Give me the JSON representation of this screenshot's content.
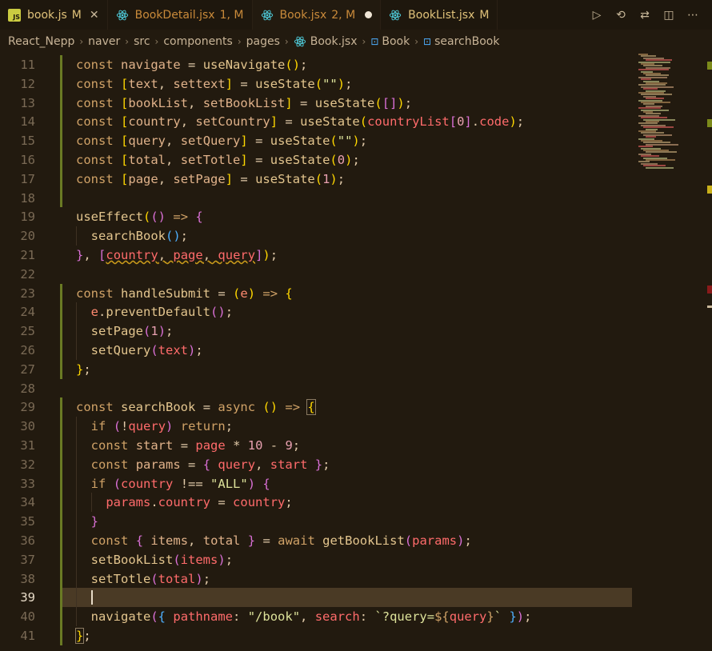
{
  "tabs": [
    {
      "label": "book.js",
      "status": "M",
      "icon": "js-icon",
      "color": "#e0c27a",
      "active": false,
      "closable": true
    },
    {
      "label": "BookDetail.jsx",
      "status": "1, M",
      "icon": "react-icon",
      "color": "#c98a3a",
      "active": false
    },
    {
      "label": "Book.jsx",
      "status": "2, M",
      "icon": "react-icon",
      "color": "#c98a3a",
      "active": true,
      "dirty": true
    },
    {
      "label": "BookList.jsx",
      "status": "M",
      "icon": "react-icon",
      "color": "#e0c27a",
      "active": false
    }
  ],
  "breadcrumb": {
    "items": [
      "React_Nepp",
      "naver",
      "src",
      "components",
      "pages",
      "Book.jsx",
      "Book",
      "searchBook"
    ]
  },
  "editor": {
    "current_line": 39,
    "lines": [
      {
        "n": "11",
        "html": "<span class='kw'>const</span> <span class='var'>navigate</span> <span class='pl'>=</span> <span class='fn'>useNavigate</span><span class='br1'>()</span><span class='pl'>;</span>"
      },
      {
        "n": "12",
        "html": "<span class='kw'>const</span> <span class='br1'>[</span><span class='var'>text</span><span class='pl'>,</span> <span class='var'>settext</span><span class='br1'>]</span> <span class='pl'>=</span> <span class='fn'>useState</span><span class='br1'>(</span><span class='str'>\"\"</span><span class='br1'>)</span><span class='pl'>;</span>"
      },
      {
        "n": "13",
        "html": "<span class='kw'>const</span> <span class='br1'>[</span><span class='var'>bookList</span><span class='pl'>,</span> <span class='var'>setBookList</span><span class='br1'>]</span> <span class='pl'>=</span> <span class='fn'>useState</span><span class='br1'>(</span><span class='br2'>[]</span><span class='br1'>)</span><span class='pl'>;</span>"
      },
      {
        "n": "14",
        "html": "<span class='kw'>const</span> <span class='br1'>[</span><span class='var'>country</span><span class='pl'>,</span> <span class='var'>setCountry</span><span class='br1'>]</span> <span class='pl'>=</span> <span class='fn'>useState</span><span class='br1'>(</span><span class='prop'>countryList</span><span class='br2'>[</span><span class='num'>0</span><span class='br2'>]</span><span class='pl'>.</span><span class='prop'>code</span><span class='br1'>)</span><span class='pl'>;</span>"
      },
      {
        "n": "15",
        "html": "<span class='kw'>const</span> <span class='br1'>[</span><span class='var'>query</span><span class='pl'>,</span> <span class='var'>setQuery</span><span class='br1'>]</span> <span class='pl'>=</span> <span class='fn'>useState</span><span class='br1'>(</span><span class='str'>\"\"</span><span class='br1'>)</span><span class='pl'>;</span>"
      },
      {
        "n": "16",
        "html": "<span class='kw'>const</span> <span class='br1'>[</span><span class='var'>total</span><span class='pl'>,</span> <span class='var'>setTotle</span><span class='br1'>]</span> <span class='pl'>=</span> <span class='fn'>useState</span><span class='br1'>(</span><span class='num'>0</span><span class='br1'>)</span><span class='pl'>;</span>"
      },
      {
        "n": "17",
        "html": "<span class='kw'>const</span> <span class='br1'>[</span><span class='var'>page</span><span class='pl'>,</span> <span class='var'>setPage</span><span class='br1'>]</span> <span class='pl'>=</span> <span class='fn'>useState</span><span class='br1'>(</span><span class='num'>1</span><span class='br1'>)</span><span class='pl'>;</span>"
      },
      {
        "n": "18",
        "html": ""
      },
      {
        "n": "19",
        "html": "<span class='fn'>useEffect</span><span class='br1'>(</span><span class='br2'>()</span> <span class='kw'>=&gt;</span> <span class='br2'>{</span>"
      },
      {
        "n": "20",
        "html": "  <span class='fn'>searchBook</span><span class='br3'>()</span><span class='pl'>;</span>"
      },
      {
        "n": "21",
        "html": "<span class='br2'>}</span><span class='pl'>,</span> <span class='br2'>[</span><span class='prop sq'>country</span><span class='pl sq'>,</span><span class='sq'> </span><span class='prop sq'>page</span><span class='pl sq'>,</span><span class='sq'> </span><span class='prop sq'>query</span><span class='br2'>]</span><span class='br1'>)</span><span class='pl'>;</span>"
      },
      {
        "n": "22",
        "html": ""
      },
      {
        "n": "23",
        "html": "<span class='kw'>const</span> <span class='fn'>handleSubmit</span> <span class='pl'>=</span> <span class='br1'>(</span><span class='par'>e</span><span class='br1'>)</span> <span class='kw'>=&gt;</span> <span class='br1'>{</span>"
      },
      {
        "n": "24",
        "html": "  <span class='par'>e</span><span class='pl'>.</span><span class='fn'>preventDefault</span><span class='br2'>()</span><span class='pl'>;</span>"
      },
      {
        "n": "25",
        "html": "  <span class='fn'>setPage</span><span class='br2'>(</span><span class='num'>1</span><span class='br2'>)</span><span class='pl'>;</span>"
      },
      {
        "n": "26",
        "html": "  <span class='fn'>setQuery</span><span class='br2'>(</span><span class='prop'>text</span><span class='br2'>)</span><span class='pl'>;</span>"
      },
      {
        "n": "27",
        "html": "<span class='br1'>}</span><span class='pl'>;</span>"
      },
      {
        "n": "28",
        "html": ""
      },
      {
        "n": "29",
        "html": "<span class='kw'>const</span> <span class='fn'>searchBook</span> <span class='pl'>=</span> <span class='kw'>async</span> <span class='br1'>()</span> <span class='kw'>=&gt;</span> <span class='br1' style='outline:1px solid #8a7a62'>{</span>"
      },
      {
        "n": "30",
        "html": "  <span class='kw'>if</span> <span class='br2'>(</span><span class='pl'>!</span><span class='prop'>query</span><span class='br2'>)</span> <span class='kw'>return</span><span class='pl'>;</span>"
      },
      {
        "n": "31",
        "html": "  <span class='kw'>const</span> <span class='var'>start</span> <span class='pl'>=</span> <span class='prop'>page</span> <span class='pl'>*</span> <span class='num'>10</span> <span class='pl'>-</span> <span class='num'>9</span><span class='pl'>;</span>"
      },
      {
        "n": "32",
        "html": "  <span class='kw'>const</span> <span class='var'>params</span> <span class='pl'>=</span> <span class='br2'>{</span> <span class='prop'>query</span><span class='pl'>,</span> <span class='prop'>start</span> <span class='br2'>}</span><span class='pl'>;</span>"
      },
      {
        "n": "33",
        "html": "  <span class='kw'>if</span> <span class='br2'>(</span><span class='prop'>country</span> <span class='pl'>!==</span> <span class='str'>\"ALL\"</span><span class='br2'>)</span> <span class='br2'>{</span>"
      },
      {
        "n": "34",
        "html": "    <span class='prop'>params</span><span class='pl'>.</span><span class='prop'>country</span> <span class='pl'>=</span> <span class='prop'>country</span><span class='pl'>;</span>"
      },
      {
        "n": "35",
        "html": "  <span class='br2'>}</span>"
      },
      {
        "n": "36",
        "html": "  <span class='kw'>const</span> <span class='br2'>{</span> <span class='var'>items</span><span class='pl'>,</span> <span class='var'>total</span> <span class='br2'>}</span> <span class='pl'>=</span> <span class='kw'>await</span> <span class='fn'>getBookList</span><span class='br2'>(</span><span class='prop'>params</span><span class='br2'>)</span><span class='pl'>;</span>"
      },
      {
        "n": "37",
        "html": "  <span class='fn'>setBookList</span><span class='br2'>(</span><span class='prop'>items</span><span class='br2'>)</span><span class='pl'>;</span>"
      },
      {
        "n": "38",
        "html": "  <span class='fn'>setTotle</span><span class='br2'>(</span><span class='prop'>total</span><span class='br2'>)</span><span class='pl'>;</span>"
      },
      {
        "n": "39",
        "html": "  <span style='border-left:2px solid #e8dcc8'></span>"
      },
      {
        "n": "40",
        "html": "  <span class='fn'>navigate</span><span class='br2'>(</span><span class='br3'>{</span> <span class='prop'>pathname</span><span class='pl'>:</span> <span class='str'>\"/book\"</span><span class='pl'>,</span> <span class='prop'>search</span><span class='pl'>:</span> <span class='str'>`?query=</span><span class='kw'>${</span><span class='prop'>query</span><span class='kw'>}</span><span class='str'>`</span> <span class='br3'>}</span><span class='br2'>)</span><span class='pl'>;</span>"
      },
      {
        "n": "41",
        "html": "<span class='br1' style='outline:1px solid #8a7a62'>}</span><span class='pl'>;</span>"
      }
    ]
  }
}
